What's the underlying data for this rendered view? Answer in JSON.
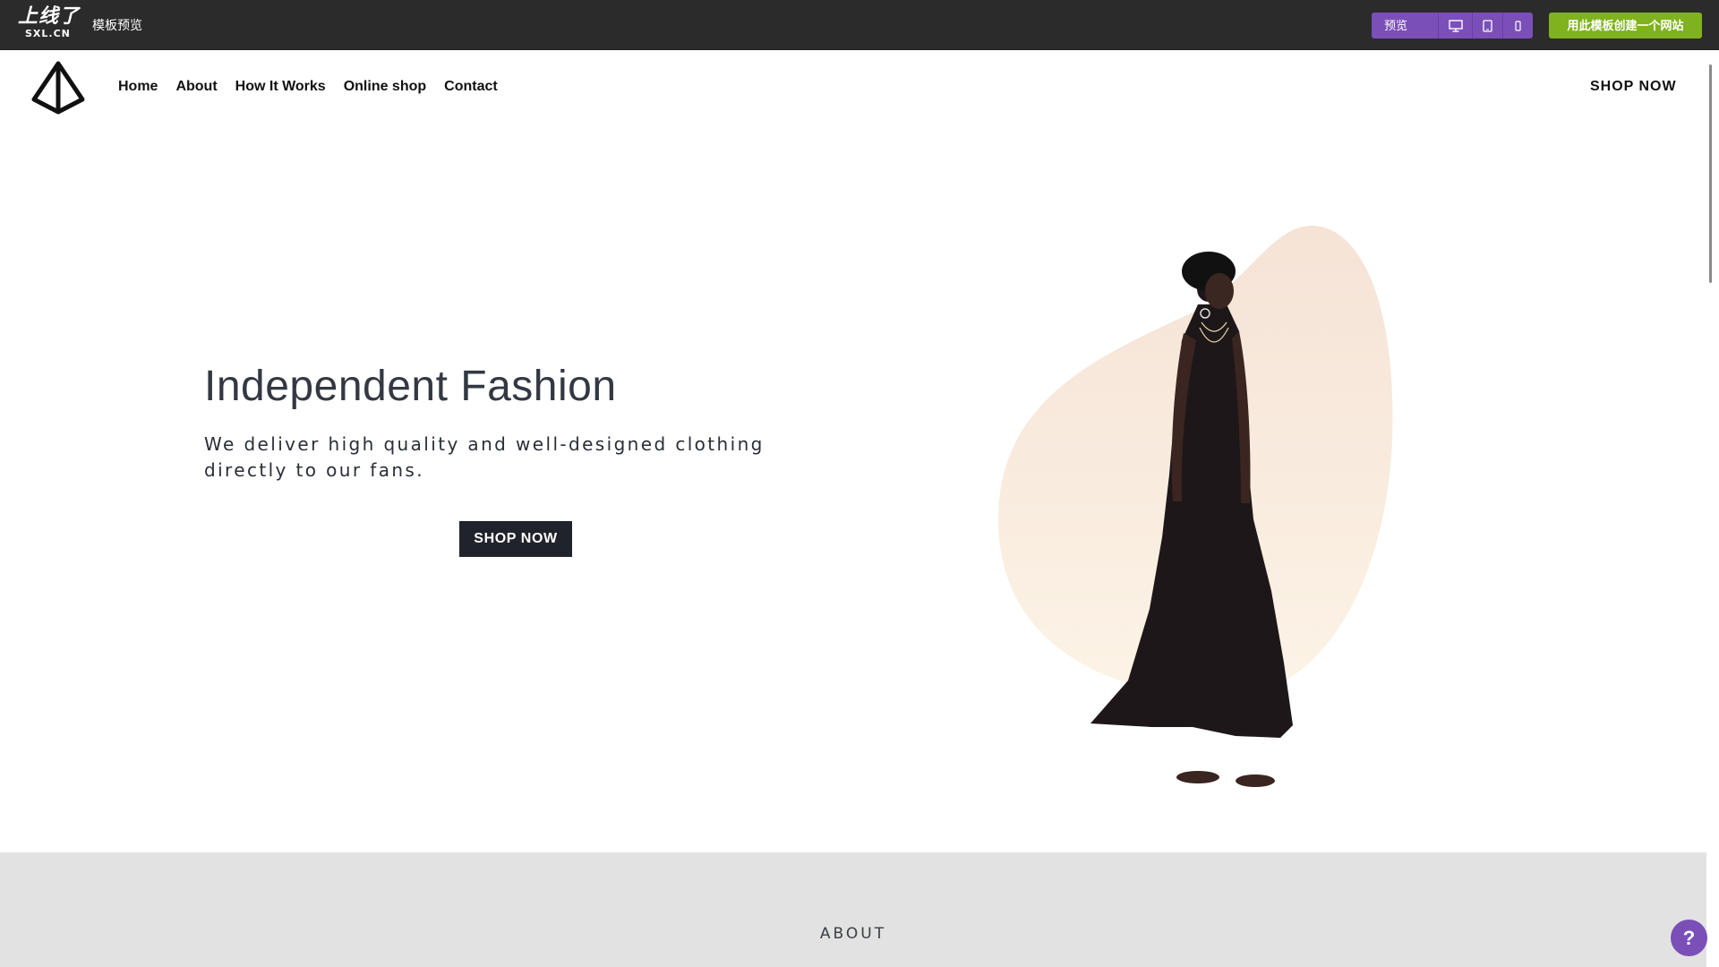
{
  "topbar": {
    "brand_logo": "上线了",
    "brand_sub": "SXL.CN",
    "title": "模板预览",
    "preview_label": "预览",
    "create_button": "用此模板创建一个网站",
    "accent_purple": "#7b4fb8",
    "accent_green": "#7fb21e"
  },
  "header": {
    "nav": [
      "Home",
      "About",
      "How It Works",
      "Online shop",
      "Contact"
    ],
    "shop_now": "SHOP NOW"
  },
  "hero": {
    "title": "Independent Fashion",
    "subtitle": "We deliver high quality and well-designed clothing directly to our fans.",
    "button": "SHOP NOW",
    "blob_color": "#f5e6d8"
  },
  "about": {
    "label": "ABOUT"
  },
  "help": {
    "label": "?"
  }
}
